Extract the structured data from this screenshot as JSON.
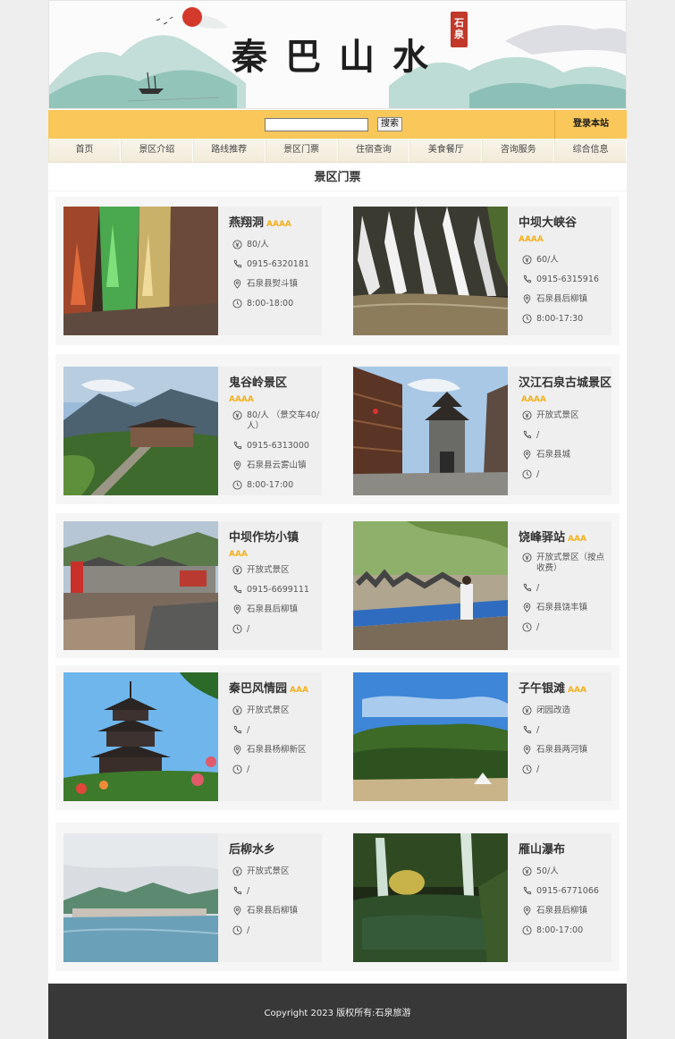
{
  "banner": {
    "title": "秦巴山水",
    "seal": "石泉"
  },
  "search": {
    "value": "",
    "placeholder": "",
    "button": "搜索"
  },
  "login": "登录本站",
  "nav": [
    "首页",
    "景区介绍",
    "路线推荐",
    "景区门票",
    "住宿查询",
    "美食餐厅",
    "咨询服务",
    "综合信息"
  ],
  "section_title": "景区门票",
  "colors": {
    "accent": "#f9c75a",
    "grade": "#f3b01c",
    "footer": "#383838"
  },
  "icons": {
    "price": "yuan-circle-icon",
    "phone": "phone-icon",
    "location": "location-pin-icon",
    "hours": "clock-icon"
  },
  "attractions": [
    {
      "name": "燕翔洞",
      "grade": "AAAA",
      "price": "80/人",
      "phone": "0915-6320181",
      "address": "石泉县熨斗镇",
      "hours": "8:00-18:00"
    },
    {
      "name": "中坝大峡谷",
      "grade": "AAAA",
      "price": "60/人",
      "phone": "0915-6315916",
      "address": "石泉县后柳镇",
      "hours": "8:00-17:30"
    },
    {
      "name": "鬼谷岭景区",
      "grade": "AAAA",
      "price": "80/人 （景交车40/人）",
      "phone": "0915-6313000",
      "address": "石泉县云雾山镇",
      "hours": "8:00-17:00"
    },
    {
      "name": "汉江石泉古城景区",
      "grade": "AAAA",
      "price": "开放式景区",
      "phone": "/",
      "address": "石泉县城",
      "hours": "/"
    },
    {
      "name": "中坝作坊小镇",
      "grade": "AAA",
      "price": "开放式景区",
      "phone": "0915-6699111",
      "address": "石泉县后柳镇",
      "hours": "/"
    },
    {
      "name": "饶峰驿站",
      "grade": "AAA",
      "price": "开放式景区（按点收费）",
      "phone": "/",
      "address": "石泉县饶丰镇",
      "hours": "/"
    },
    {
      "name": "秦巴风情园",
      "grade": "AAA",
      "price": "开放式景区",
      "phone": "/",
      "address": "石泉县杨柳新区",
      "hours": "/"
    },
    {
      "name": "子午银滩",
      "grade": "AAA",
      "price": "闭园改造",
      "phone": "/",
      "address": "石泉县两河镇",
      "hours": "/"
    },
    {
      "name": "后柳水乡",
      "grade": "",
      "price": "开放式景区",
      "phone": "/",
      "address": "石泉县后柳镇",
      "hours": "/"
    },
    {
      "name": "雁山瀑布",
      "grade": "",
      "price": "50/人",
      "phone": "0915-6771066",
      "address": "石泉县后柳镇",
      "hours": "8:00-17:00"
    }
  ],
  "footer": "Copyright 2023   版权所有:石泉旅游"
}
